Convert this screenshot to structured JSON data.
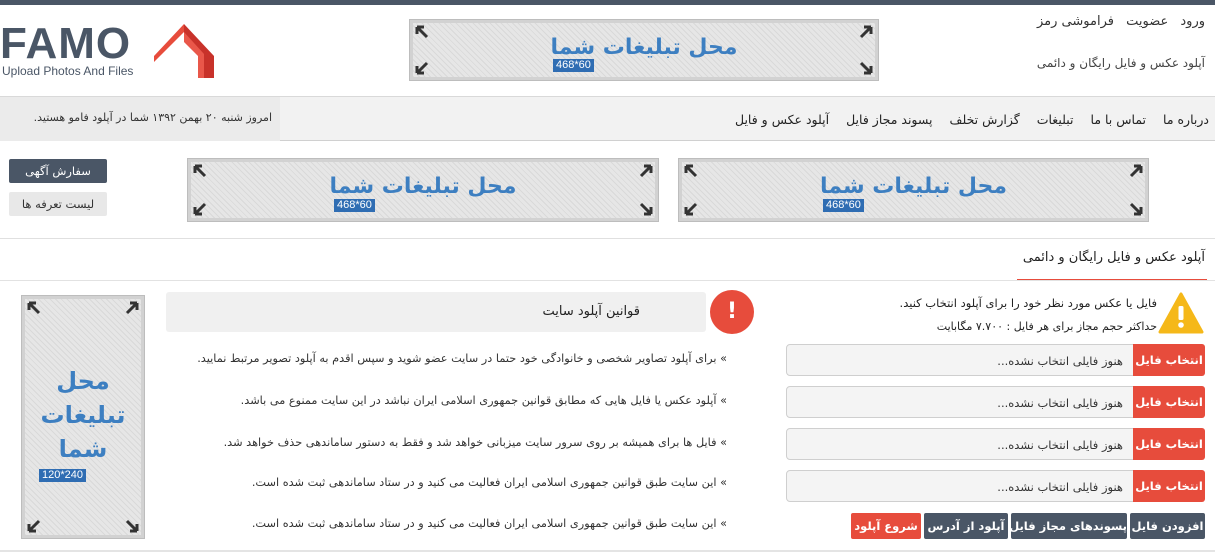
{
  "header": {
    "logo_text": "FAMO",
    "logo_subtitle": "Upload Photos And Files",
    "top_links": [
      "ورود",
      "عضویت",
      "فراموشی رمز"
    ],
    "tagline": "آپلود عکس و فایل رایگان و دائمی"
  },
  "ads": {
    "banner_text": "محل تبلیغات شما",
    "banner_size": "468*60",
    "sky_line1": "محل",
    "sky_line2": "تبلیغات",
    "sky_line3": "شما",
    "sky_size": "120*240"
  },
  "nav": {
    "items": [
      "آپلود عکس و فایل",
      "پسوند مجاز فایل",
      "گزارش تخلف",
      "تبلیغات",
      "تماس با ما",
      "درباره ما"
    ],
    "date_text": "امروز شنبه ۲۰ بهمن ۱۳۹۲ شما در آپلود فامو هستید."
  },
  "side_buttons": {
    "order_ad": "سفارش آگهی",
    "price_list": "لیست تعرفه ها"
  },
  "upload": {
    "panel_title": "آپلود عکس و فایل رایگان و دائمی",
    "note": "فایل یا عکس مورد نظر خود را برای آپلود انتخاب کنید.",
    "limit": "حداکثر حجم مجاز برای هر فایل : ۷.۷۰۰ مگابایت",
    "file_rows": [
      {
        "button": "انتخاب فایل",
        "text": "هنوز فایلی انتخاب نشده..."
      },
      {
        "button": "انتخاب فایل",
        "text": "هنوز فایلی انتخاب نشده..."
      },
      {
        "button": "انتخاب فایل",
        "text": "هنوز فایلی انتخاب نشده..."
      },
      {
        "button": "انتخاب فایل",
        "text": "هنوز فایلی انتخاب نشده..."
      }
    ],
    "actions": {
      "add_file": "افزودن فایل",
      "allowed_ext": "پسوندهای مجاز فایل",
      "from_url": "آپلود از آدرس",
      "start": "شروع آپلود"
    }
  },
  "rules": {
    "title": "قوانین آپلود سایت",
    "alert_symbol": "!",
    "items": [
      "» برای آپلود تصاویر شخصی و خانوادگی خود حتما در سایت عضو شوید و سپس اقدم به آپلود تصویر مرتبط نمایید.",
      "» آپلود عکس یا فایل هایی که مطابق قوانین جمهوری اسلامی ایران نباشد در این سایت ممنوع می باشد.",
      "» فایل ها برای همیشه بر روی سرور سایت میزبانی خواهد شد و فقط به دستور ساماندهی حذف خواهد شد.",
      "» این سایت طبق قوانین جمهوری اسلامی ایران فعالیت می کنید و در ستاد ساماندهی ثبت شده است.",
      "» این سایت طبق قوانین جمهوری اسلامی ایران فعالیت می کنید و در ستاد ساماندهی ثبت شده است."
    ]
  },
  "colors": {
    "dark": "#4a5666",
    "accent": "#e74c3c",
    "ad_text": "#3d7fc1",
    "warning": "#f5b819"
  }
}
